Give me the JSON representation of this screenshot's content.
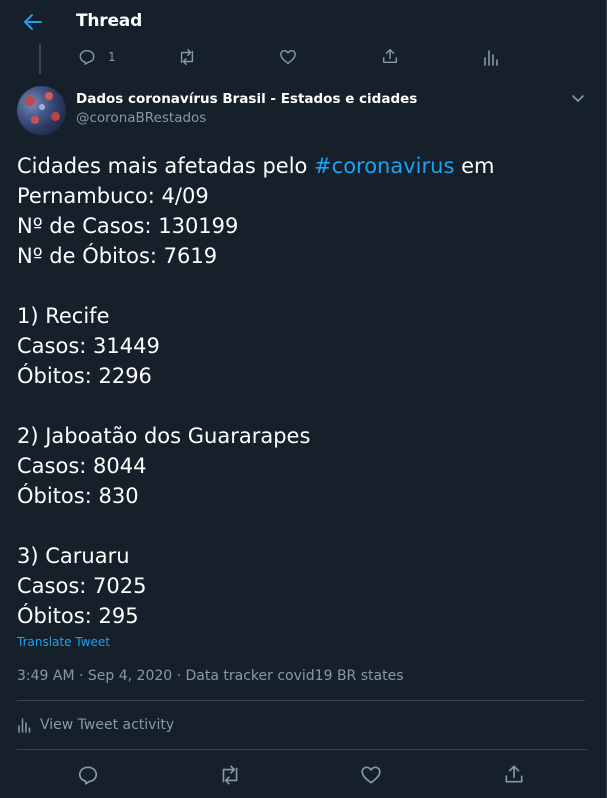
{
  "header": {
    "title": "Thread"
  },
  "previous_tweet": {
    "reply_count": "1"
  },
  "tweet": {
    "author_name": "Dados coronavírus Brasil - Estados e cidades",
    "author_handle": "@coronaBRestados",
    "text_before_hashtag": "Cidades mais afetadas pelo ",
    "hashtag": "#coronavirus",
    "text_after_hashtag": " em\nPernambuco: 4/09\nNº de Casos: 130199\nNº de Óbitos: 7619\n\n1) Recife\nCasos: 31449\nÓbitos: 2296\n\n2) Jaboatão dos Guararapes\nCasos: 8044\nÓbitos: 830\n\n3) Caruaru\nCasos: 7025\nÓbitos: 295",
    "translate_label": "Translate Tweet",
    "timestamp": "3:49 AM · Sep 4, 2020",
    "source_separator": " · ",
    "source": "Data tracker covid19 BR states",
    "activity_label": "View Tweet activity"
  },
  "colors": {
    "background": "#15202b",
    "accent": "#1da1f2",
    "muted": "#8899a6",
    "divider": "#38444d"
  },
  "icons": {
    "back": "arrow-left-icon",
    "reply": "comment-icon",
    "retweet": "retweet-icon",
    "like": "heart-icon",
    "share": "share-icon",
    "analytics": "bar-chart-icon",
    "more": "chevron-down-icon"
  }
}
